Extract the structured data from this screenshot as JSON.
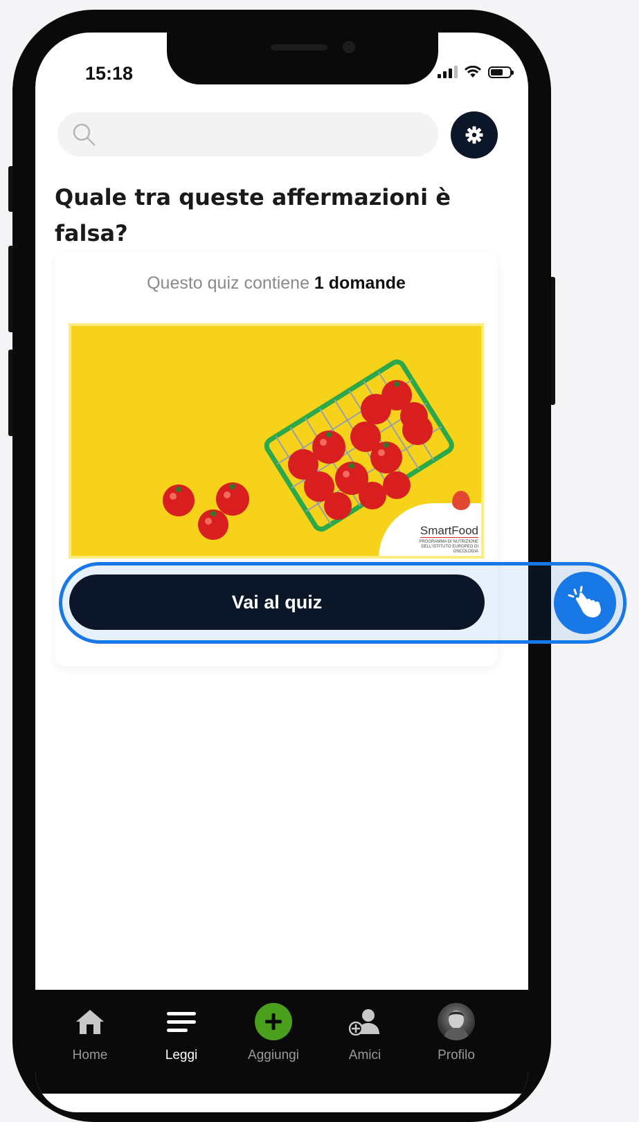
{
  "status_bar": {
    "time": "15:18"
  },
  "search": {
    "placeholder": ""
  },
  "quiz": {
    "title": "Quale tra queste affermazioni è falsa?",
    "info_prefix": "Questo quiz contiene ",
    "info_count": "1 domande",
    "image_brand": "SmartFood",
    "image_brand_sub": "PROGRAMMA DI NUTRIZIONE DELL'ISTITUTO EUROPEO DI ONCOLOGIA",
    "go_button": "Vai al quiz"
  },
  "tabbar": {
    "items": [
      {
        "label": "Home",
        "icon": "home-icon",
        "active": false
      },
      {
        "label": "Leggi",
        "icon": "menu-lines-icon",
        "active": true
      },
      {
        "label": "Aggiungi",
        "icon": "plus-icon",
        "active": false
      },
      {
        "label": "Amici",
        "icon": "add-friend-icon",
        "active": false
      },
      {
        "label": "Profilo",
        "icon": "avatar",
        "active": false
      }
    ]
  },
  "colors": {
    "dark_navy": "#0b1729",
    "accent_green": "#4aa01c",
    "highlight_blue": "#1878e6",
    "image_yellow": "#f7d21a"
  }
}
